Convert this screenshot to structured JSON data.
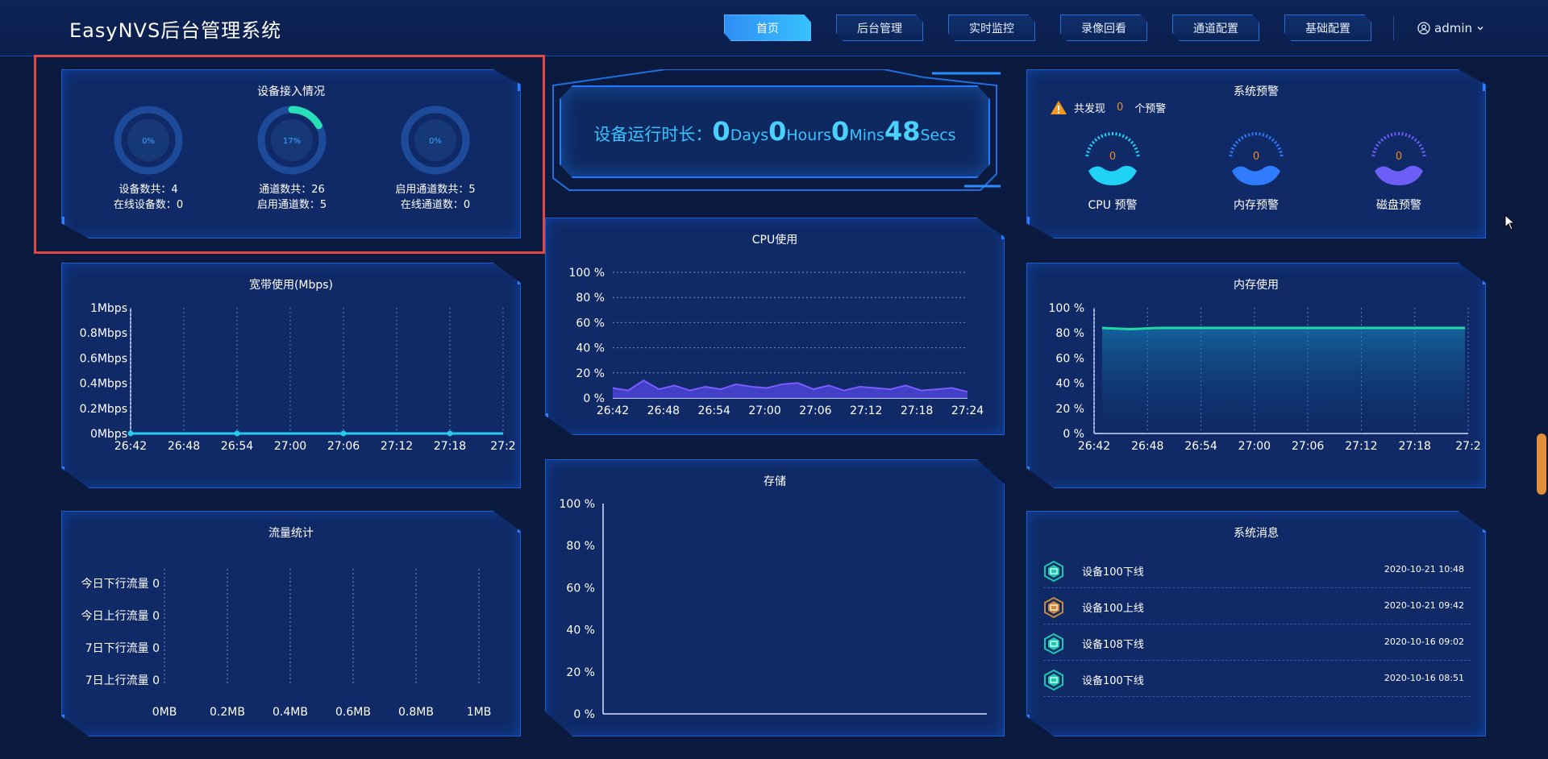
{
  "header": {
    "title": "EasyNVS后台管理系统",
    "nav": [
      "首页",
      "后台管理",
      "实时监控",
      "录像回看",
      "通道配置",
      "基础配置"
    ],
    "active_nav": "首页",
    "user": "admin"
  },
  "device_access": {
    "title": "设备接入情况",
    "rings": [
      {
        "percent": "0%",
        "value": 0,
        "line1": "设备数共：4",
        "line2": "在线设备数：0"
      },
      {
        "percent": "17%",
        "value": 17,
        "line1": "通道数共：26",
        "line2": "启用通道数：5"
      },
      {
        "percent": "0%",
        "value": 0,
        "line1": "启用通道数共：5",
        "line2": "在线通道数：0"
      }
    ]
  },
  "runtime": {
    "label": "设备运行时长：",
    "days": "0",
    "days_unit": "Days",
    "hours": "0",
    "hours_unit": "Hours",
    "mins": "0",
    "mins_unit": "Mins",
    "secs": "48",
    "secs_unit": "Secs"
  },
  "system_warning": {
    "title": "系统预警",
    "summary_prefix": "共发现",
    "summary_count": "0",
    "summary_suffix": "个预警",
    "gauges": [
      {
        "label": "CPU 预警",
        "value": "0"
      },
      {
        "label": "内存预警",
        "value": "0"
      },
      {
        "label": "磁盘预警",
        "value": "0"
      }
    ]
  },
  "bandwidth": {
    "title": "宽带使用(Mbps)"
  },
  "cpu": {
    "title": "CPU使用"
  },
  "memory": {
    "title": "内存使用"
  },
  "traffic": {
    "title": "流量统计"
  },
  "storage": {
    "title": "存储"
  },
  "messages": {
    "title": "系统消息",
    "items": [
      {
        "text": "设备100下线",
        "time": "2020-10-21 10:48",
        "color": "#1fc7b0"
      },
      {
        "text": "设备100上线",
        "time": "2020-10-21 09:42",
        "color": "#c98a3a"
      },
      {
        "text": "设备108下线",
        "time": "2020-10-16 09:02",
        "color": "#1fc7b0"
      },
      {
        "text": "设备100下线",
        "time": "2020-10-16 08:51",
        "color": "#1fc7b0"
      }
    ]
  },
  "chart_data": [
    {
      "type": "line",
      "title": "宽带使用(Mbps)",
      "x": [
        "26:42",
        "26:48",
        "26:54",
        "27:00",
        "27:06",
        "27:12",
        "27:18",
        "27:2"
      ],
      "y_ticks": [
        "1Mbps",
        "0.8Mbps",
        "0.6Mbps",
        "0.4Mbps",
        "0.2Mbps",
        "0Mbps"
      ],
      "ylim": [
        0,
        1
      ],
      "series": [
        {
          "values": [
            0,
            0,
            0,
            0,
            0,
            0,
            0,
            0
          ]
        }
      ]
    },
    {
      "type": "area",
      "title": "CPU使用",
      "x": [
        "26:42",
        "26:48",
        "26:54",
        "27:00",
        "27:06",
        "27:12",
        "27:18",
        "27:24"
      ],
      "y_ticks": [
        "100 %",
        "80 %",
        "60 %",
        "40 %",
        "20 %",
        "0 %"
      ],
      "ylim": [
        0,
        100
      ],
      "series": [
        {
          "values": [
            8,
            6,
            14,
            7,
            10,
            6,
            9,
            7,
            11,
            9,
            8,
            11,
            12,
            7,
            10,
            6,
            9,
            8,
            7,
            10,
            6,
            7,
            8,
            5
          ]
        }
      ]
    },
    {
      "type": "area",
      "title": "内存使用",
      "x": [
        "26:42",
        "26:48",
        "26:54",
        "27:00",
        "27:06",
        "27:12",
        "27:18",
        "27:2"
      ],
      "y_ticks": [
        "100 %",
        "80 %",
        "60 %",
        "40 %",
        "20 %",
        "0 %"
      ],
      "ylim": [
        0,
        100
      ],
      "series": [
        {
          "values": [
            84,
            83,
            84,
            84,
            84,
            84,
            84,
            84,
            84,
            84,
            84,
            84,
            84,
            84
          ]
        }
      ]
    },
    {
      "type": "bar",
      "title": "流量统计",
      "categories": [
        "今日下行流量",
        "今日上行流量",
        "7日下行流量",
        "7日上行流量"
      ],
      "values": [
        0,
        0,
        0,
        0
      ],
      "x_ticks": [
        "0MB",
        "0.2MB",
        "0.4MB",
        "0.6MB",
        "0.8MB",
        "1MB"
      ],
      "xlim": [
        0,
        1
      ]
    },
    {
      "type": "line",
      "title": "存储",
      "y_ticks": [
        "100 %",
        "80 %",
        "60 %",
        "40 %",
        "20 %",
        "0 %"
      ],
      "ylim": [
        0,
        100
      ],
      "series": []
    }
  ]
}
